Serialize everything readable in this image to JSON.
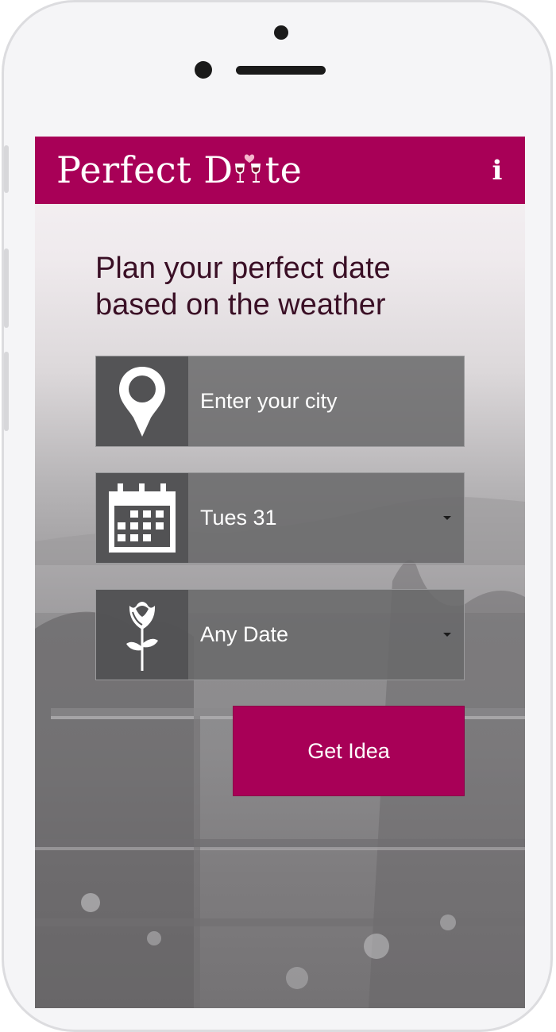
{
  "app": {
    "logo": {
      "text_before": "Perfect D",
      "text_after": "te",
      "emblem": "wine-glasses-heart-icon"
    },
    "info_label": "i"
  },
  "main": {
    "headline_line1": "Plan your perfect date",
    "headline_line2": "based on the weather"
  },
  "form": {
    "city": {
      "placeholder": "Enter your city",
      "icon": "location-pin-icon"
    },
    "day": {
      "value": "Tues 31",
      "icon": "calendar-icon"
    },
    "date_type": {
      "value": "Any Date",
      "icon": "rose-icon"
    },
    "submit_label": "Get Idea"
  },
  "colors": {
    "brand": "#a80057",
    "headline": "#3a0f25",
    "field_bg": "#686868",
    "icon_box_bg": "#525254"
  }
}
